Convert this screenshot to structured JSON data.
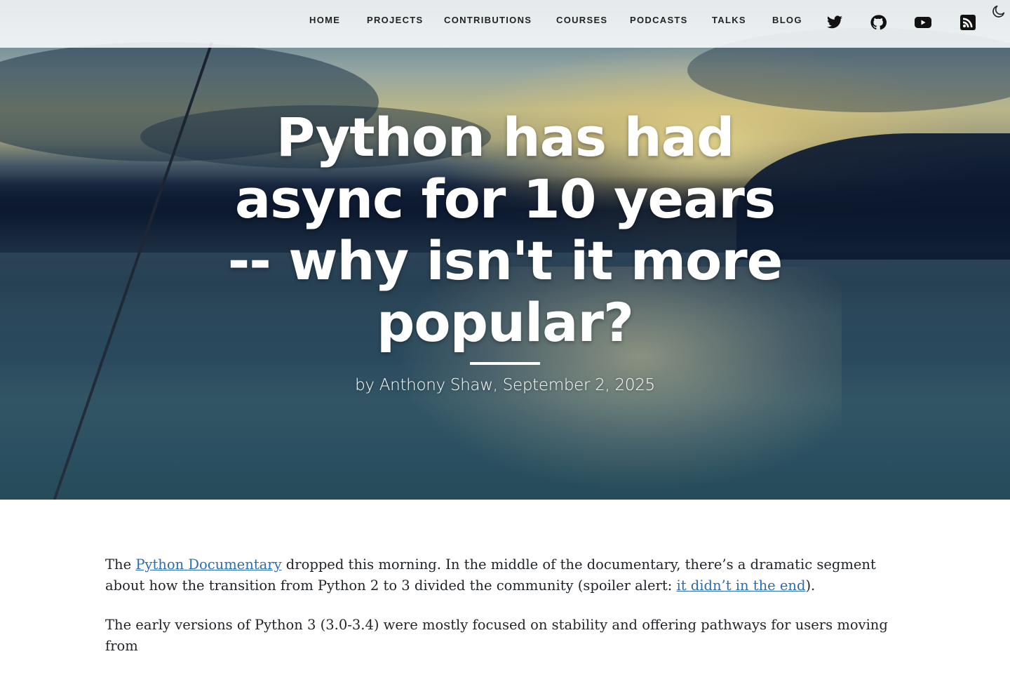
{
  "nav": {
    "links": [
      {
        "label": "HOME"
      },
      {
        "label": "PROJECTS"
      },
      {
        "label": "CONTRIBUTIONS"
      },
      {
        "label": "COURSES"
      },
      {
        "label": "PODCASTS"
      },
      {
        "label": "TALKS"
      },
      {
        "label": "BLOG"
      }
    ],
    "icons": [
      "twitter-icon",
      "github-icon",
      "youtube-icon",
      "rss-icon"
    ],
    "theme_toggle_icon": "moon-icon"
  },
  "post": {
    "title": "Python has had async for 10 years -- why isn't it more popular?",
    "meta": "by Anthony Shaw, September 2, 2025"
  },
  "article": {
    "p1": {
      "t1": "The ",
      "link1": "Python Documentary",
      "t2": " dropped this morning. In the middle of the documentary, there’s a dramatic segment about how the transition from Python 2 to 3 divided the community (spoiler alert: ",
      "link2": "it didn’t in the end",
      "t3": ")."
    },
    "p2": "The early versions of Python 3 (3.0-3.4) were mostly focused on stability and offering pathways for users moving from"
  },
  "colors": {
    "nav_text": "#222222",
    "link": "#2a6eb0",
    "body_text": "#212529",
    "title_text": "#ffffff"
  }
}
